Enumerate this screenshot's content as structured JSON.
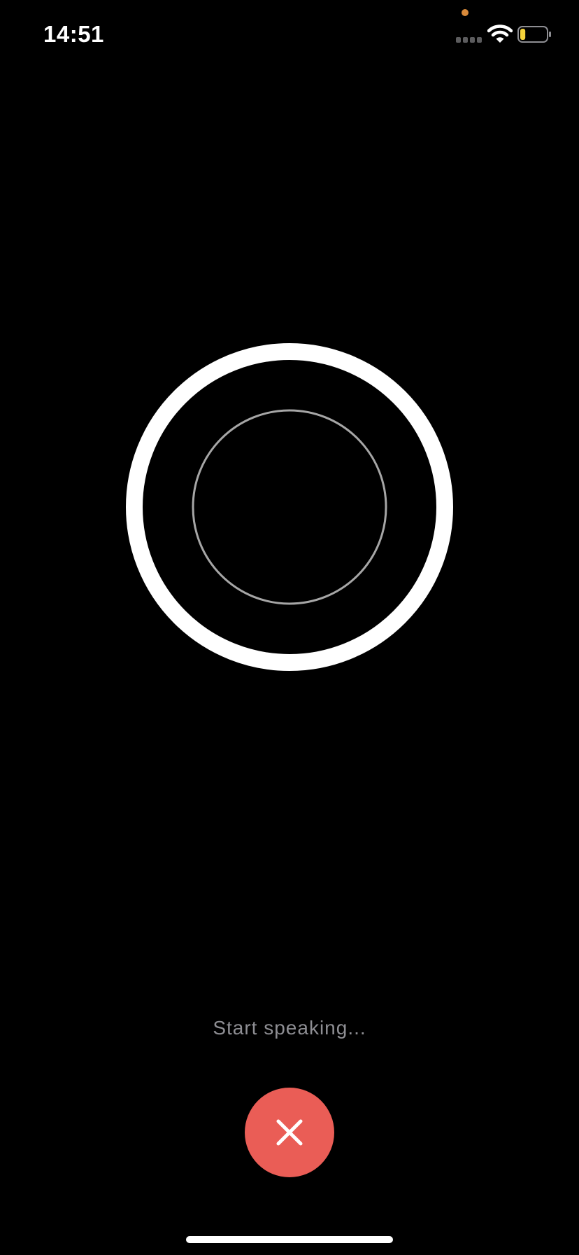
{
  "status_bar": {
    "time": "14:51",
    "icons": [
      "privacy-indicator-dot",
      "cellular-signal-icon",
      "wifi-icon",
      "battery-icon"
    ],
    "battery_level": 0.2,
    "colors": {
      "privacy_dot": "#d98a3a",
      "battery_fill": "#f5d33b"
    }
  },
  "voice_visual": {
    "icons": [
      "outer-ring",
      "inner-ring"
    ],
    "colors": {
      "outer_ring": "#ffffff",
      "inner_ring": "#a6a6a6"
    }
  },
  "prompt": {
    "text": "Start speaking...",
    "color": "#8e8e93"
  },
  "cancel_button": {
    "icon": "close-icon",
    "color": "#ea5d56"
  }
}
